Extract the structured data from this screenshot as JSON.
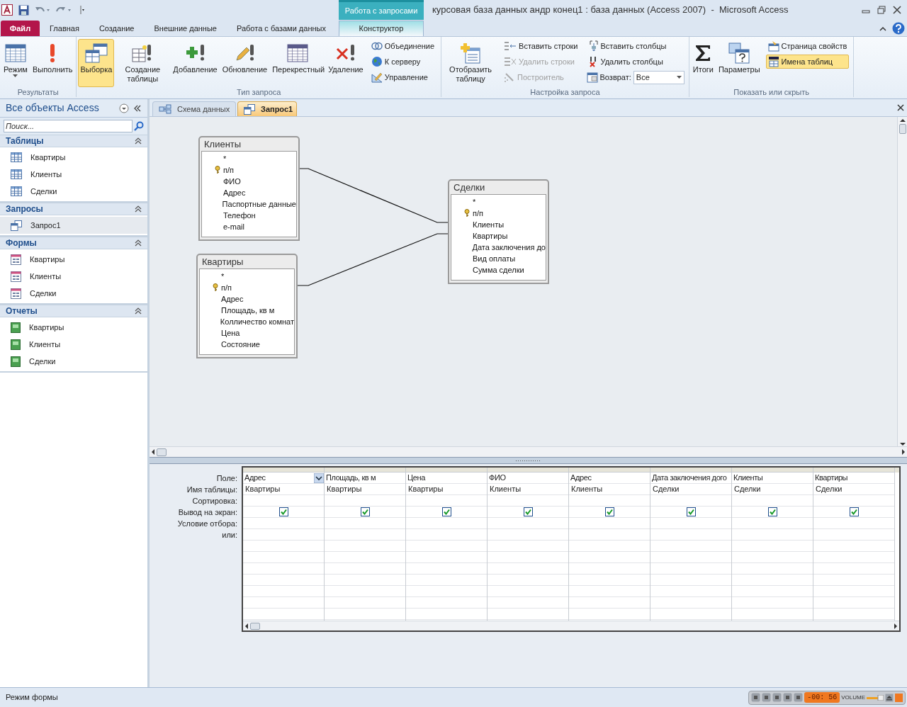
{
  "context_tab": {
    "label": "Работа с запросами"
  },
  "window": {
    "title": "курсовая база данных андр конец1 : база данных (Access 2007)  -  Microsoft Access"
  },
  "ribbon_tabs": [
    {
      "label": "Файл",
      "kind": "file",
      "selected": false
    },
    {
      "label": "Главная",
      "kind": "normal",
      "selected": false
    },
    {
      "label": "Создание",
      "kind": "normal",
      "selected": false
    },
    {
      "label": "Внешние данные",
      "kind": "normal",
      "selected": false
    },
    {
      "label": "Работа с базами данных",
      "kind": "normal",
      "selected": false
    },
    {
      "label": "Конструктор",
      "kind": "contextual",
      "selected": true
    }
  ],
  "ribbon_groups": [
    {
      "label": "Результаты",
      "items": [
        {
          "kind": "large",
          "label": "Режим",
          "selected": false,
          "dropdown": true
        },
        {
          "kind": "large",
          "label": "Выполнить",
          "selected": false
        }
      ]
    },
    {
      "label": "Тип запроса",
      "items": [
        {
          "kind": "large",
          "label": "Выборка",
          "selected": true
        },
        {
          "kind": "large",
          "label": "Создание таблицы",
          "selected": false
        },
        {
          "kind": "large",
          "label": "Добавление",
          "selected": false
        },
        {
          "kind": "large",
          "label": "Обновление",
          "selected": false
        },
        {
          "kind": "large",
          "label": "Перекрестный",
          "selected": false
        },
        {
          "kind": "large",
          "label": "Удаление",
          "selected": false
        },
        {
          "kind": "small",
          "label": "Объединение",
          "disabled": false,
          "selected": false
        },
        {
          "kind": "small",
          "label": "К серверу",
          "disabled": false,
          "selected": false
        },
        {
          "kind": "small",
          "label": "Управление",
          "disabled": false,
          "selected": false
        }
      ]
    },
    {
      "label": "Настройка запроса",
      "items": [
        {
          "kind": "large",
          "label": "Отобразить таблицу",
          "selected": false
        },
        {
          "kind": "small",
          "label": "Вставить строки",
          "disabled": false,
          "selected": false
        },
        {
          "kind": "small",
          "label": "Удалить строки",
          "disabled": true,
          "selected": false
        },
        {
          "kind": "small",
          "label": "Построитель",
          "disabled": true,
          "selected": false
        },
        {
          "kind": "small",
          "label": "Вставить столбцы",
          "disabled": false,
          "selected": false
        },
        {
          "kind": "small",
          "label": "Удалить столбцы",
          "disabled": false,
          "selected": false
        },
        {
          "kind": "combo",
          "label": "Возврат:",
          "value": "Все"
        }
      ]
    },
    {
      "label": "Показать или скрыть",
      "items": [
        {
          "kind": "large",
          "label": "Итоги",
          "selected": false
        },
        {
          "kind": "large",
          "label": "Параметры",
          "selected": false
        },
        {
          "kind": "small",
          "label": "Страница свойств",
          "disabled": false,
          "selected": false
        },
        {
          "kind": "small",
          "label": "Имена таблиц",
          "disabled": false,
          "selected": true
        }
      ]
    }
  ],
  "nav_pane": {
    "title": "Все объекты Access",
    "search": {
      "placeholder": "Поиск..."
    },
    "sections": [
      {
        "title": "Таблицы",
        "kind": "tables",
        "items": [
          {
            "label": "Квартиры",
            "selected": false
          },
          {
            "label": "Клиенты",
            "selected": false
          },
          {
            "label": "Сделки",
            "selected": false
          }
        ]
      },
      {
        "title": "Запросы",
        "kind": "queries",
        "items": [
          {
            "label": "Запрос1",
            "selected": true
          }
        ]
      },
      {
        "title": "Формы",
        "kind": "forms",
        "items": [
          {
            "label": "Квартиры",
            "selected": false
          },
          {
            "label": "Клиенты",
            "selected": false
          },
          {
            "label": "Сделки",
            "selected": false
          }
        ]
      },
      {
        "title": "Отчеты",
        "kind": "reports",
        "items": [
          {
            "label": "Квартиры",
            "selected": false
          },
          {
            "label": "Клиенты",
            "selected": false
          },
          {
            "label": "Сделки",
            "selected": false
          }
        ]
      }
    ]
  },
  "doc_tabs": [
    {
      "label": "Схема данных",
      "selected": false
    },
    {
      "label": "Запрос1",
      "selected": true
    }
  ],
  "diagram_tables": [
    {
      "title": "Клиенты",
      "fields": [
        {
          "name": "*",
          "key": false
        },
        {
          "name": "п/п",
          "key": true
        },
        {
          "name": "ФИО",
          "key": false
        },
        {
          "name": "Адрес",
          "key": false
        },
        {
          "name": "Паспортные данные",
          "key": false
        },
        {
          "name": "Телефон",
          "key": false
        },
        {
          "name": "e-mail",
          "key": false
        }
      ]
    },
    {
      "title": "Квартиры",
      "fields": [
        {
          "name": "*",
          "key": false
        },
        {
          "name": "п/п",
          "key": true
        },
        {
          "name": "Адрес",
          "key": false
        },
        {
          "name": "Площадь, кв м",
          "key": false
        },
        {
          "name": "Колличество комнат",
          "key": false
        },
        {
          "name": "Цена",
          "key": false
        },
        {
          "name": "Состояние",
          "key": false
        }
      ]
    },
    {
      "title": "Сделки",
      "fields": [
        {
          "name": "*",
          "key": false
        },
        {
          "name": "п/п",
          "key": true
        },
        {
          "name": "Клиенты",
          "key": false
        },
        {
          "name": "Квартиры",
          "key": false
        },
        {
          "name": "Дата заключения до",
          "key": false
        },
        {
          "name": "Вид оплаты",
          "key": false
        },
        {
          "name": "Сумма сделки",
          "key": false
        }
      ]
    }
  ],
  "query_grid": {
    "row_labels": [
      "Поле:",
      "Имя таблицы:",
      "Сортировка:",
      "Вывод на экран:",
      "Условие отбора:",
      "или:"
    ],
    "columns": [
      {
        "field": "Адрес",
        "table": "Квартиры",
        "show": true,
        "selected": true
      },
      {
        "field": "Площадь, кв м",
        "table": "Квартиры",
        "show": true,
        "selected": false
      },
      {
        "field": "Цена",
        "table": "Квартиры",
        "show": true,
        "selected": false
      },
      {
        "field": "ФИО",
        "table": "Клиенты",
        "show": true,
        "selected": false
      },
      {
        "field": "Адрес",
        "table": "Клиенты",
        "show": true,
        "selected": false
      },
      {
        "field": "Дата заключения дого",
        "table": "Сделки",
        "show": true,
        "selected": false
      },
      {
        "field": "Клиенты",
        "table": "Сделки",
        "show": true,
        "selected": false
      },
      {
        "field": "Квартиры",
        "table": "Сделки",
        "show": true,
        "selected": false
      }
    ]
  },
  "status_bar": {
    "text": "Режим формы"
  },
  "media_player": {
    "time": "-00: 56",
    "volume_label": "VOLUME"
  }
}
